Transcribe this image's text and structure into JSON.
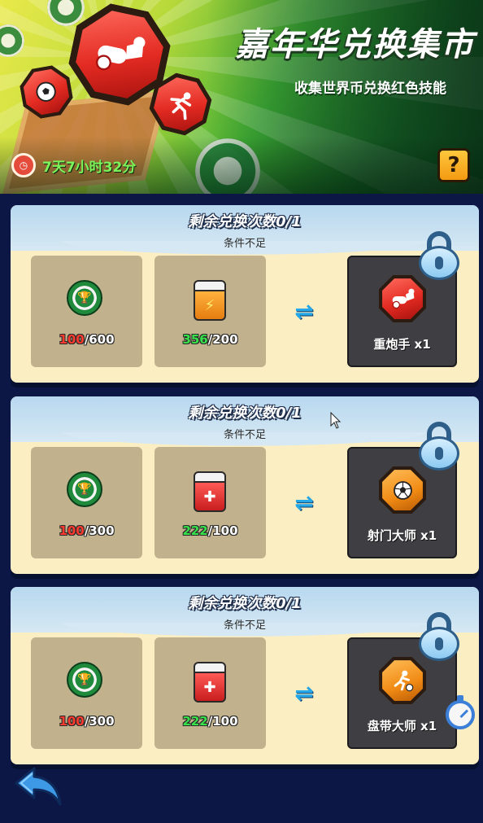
{
  "header": {
    "title": "嘉年华兑换集市",
    "subtitle": "收集世界币兑换红色技能",
    "timer": "7天7小时32分",
    "help_label": "?"
  },
  "cards": [
    {
      "title": "剩余兑换次数0/1",
      "status": "条件不足",
      "coin": {
        "have": "100",
        "need": "/600"
      },
      "cube": {
        "type": "orange",
        "have": "356",
        "need": "/200"
      },
      "reward": {
        "label": "重炮手 x1",
        "icon": "cannon-icon"
      }
    },
    {
      "title": "剩余兑换次数0/1",
      "status": "条件不足",
      "coin": {
        "have": "100",
        "need": "/300"
      },
      "cube": {
        "type": "red",
        "have": "222",
        "need": "/100"
      },
      "reward": {
        "label": "射门大师 x1",
        "icon": "soccer-ball-icon"
      }
    },
    {
      "title": "剩余兑换次数0/1",
      "status": "条件不足",
      "coin": {
        "have": "100",
        "need": "/300"
      },
      "cube": {
        "type": "red",
        "have": "222",
        "need": "/100"
      },
      "reward": {
        "label": "盘带大师 x1",
        "icon": "dribbler-icon"
      }
    }
  ],
  "colors": {
    "have_insufficient": "#ff3b30",
    "have_sufficient": "#37e24b",
    "timer": "#7cf35a",
    "exchange_arrow": "#25a8e8"
  }
}
